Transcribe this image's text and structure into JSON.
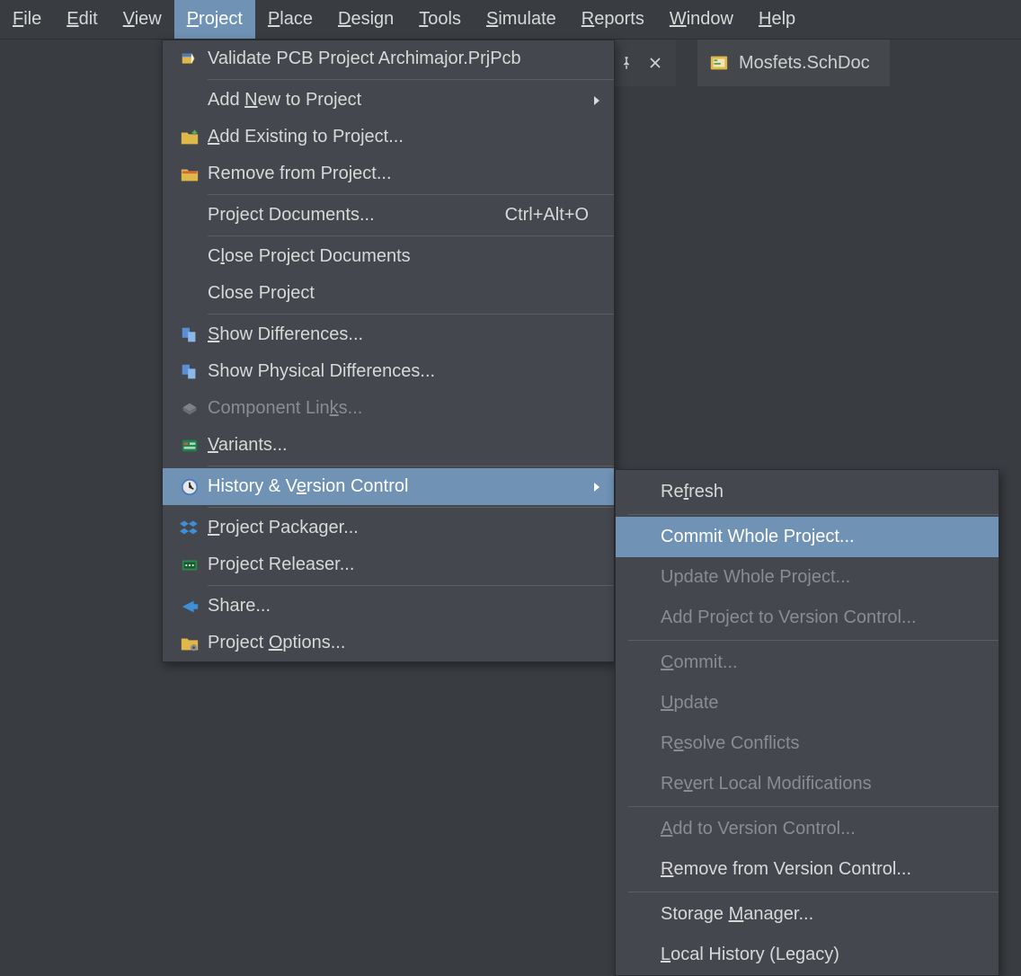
{
  "menubar": {
    "items": [
      {
        "pre": "",
        "u": "F",
        "post": "ile"
      },
      {
        "pre": "",
        "u": "E",
        "post": "dit"
      },
      {
        "pre": "",
        "u": "V",
        "post": "iew"
      },
      {
        "pre": "",
        "u": "P",
        "post": "roject"
      },
      {
        "pre": "",
        "u": "P",
        "post": "lace"
      },
      {
        "pre": "",
        "u": "D",
        "post": "esign"
      },
      {
        "pre": "",
        "u": "T",
        "post": "ools"
      },
      {
        "pre": "",
        "u": "S",
        "post": "imulate"
      },
      {
        "pre": "",
        "u": "R",
        "post": "eports"
      },
      {
        "pre": "",
        "u": "W",
        "post": "indow"
      },
      {
        "pre": "",
        "u": "H",
        "post": "elp"
      }
    ],
    "active_index": 3
  },
  "tab": {
    "doc_label": "Mosfets.SchDoc"
  },
  "project_menu": {
    "validate": "Validate PCB Project Archimajor.PrjPcb",
    "add_new": {
      "pre": "Add ",
      "u": "N",
      "post": "ew to Project"
    },
    "add_existing": {
      "pre": "",
      "u": "A",
      "post": "dd Existing to Project..."
    },
    "remove": "Remove from Project...",
    "proj_docs": "Project Documents...",
    "proj_docs_shortcut": "Ctrl+Alt+O",
    "close_docs": {
      "pre": "C",
      "u": "l",
      "post": "ose Project Documents"
    },
    "close_proj": "Close Project",
    "show_diff": {
      "pre": "",
      "u": "S",
      "post": "how Differences..."
    },
    "show_phys": "Show Physical Differences...",
    "comp_links": {
      "pre": "Component Lin",
      "u": "k",
      "post": "s..."
    },
    "variants": {
      "pre": "",
      "u": "V",
      "post": "ariants..."
    },
    "history": {
      "pre": "History & V",
      "u": "e",
      "post": "rsion Control"
    },
    "packager": {
      "pre": "",
      "u": "P",
      "post": "roject Packager..."
    },
    "releaser": "Project Releaser...",
    "share": "Share...",
    "options": {
      "pre": "Project ",
      "u": "O",
      "post": "ptions..."
    }
  },
  "vcs_submenu": {
    "refresh": {
      "pre": "Re",
      "u": "f",
      "post": "resh"
    },
    "commit_whole": "Commit Whole Project...",
    "update_whole": "Update Whole Project...",
    "add_vc": "Add Project to Version Control...",
    "commit": {
      "pre": "",
      "u": "C",
      "post": "ommit..."
    },
    "update": {
      "pre": "",
      "u": "U",
      "post": "pdate"
    },
    "resolve": {
      "pre": "R",
      "u": "e",
      "post": "solve Conflicts"
    },
    "revert": {
      "pre": "Re",
      "u": "v",
      "post": "ert Local Modifications"
    },
    "add": {
      "pre": "",
      "u": "A",
      "post": "dd to Version Control..."
    },
    "remove": {
      "pre": "",
      "u": "R",
      "post": "emove from Version Control..."
    },
    "storage": {
      "pre": "Storage ",
      "u": "M",
      "post": "anager..."
    },
    "local_hist": {
      "pre": "",
      "u": "L",
      "post": "ocal History (Legacy)"
    }
  }
}
